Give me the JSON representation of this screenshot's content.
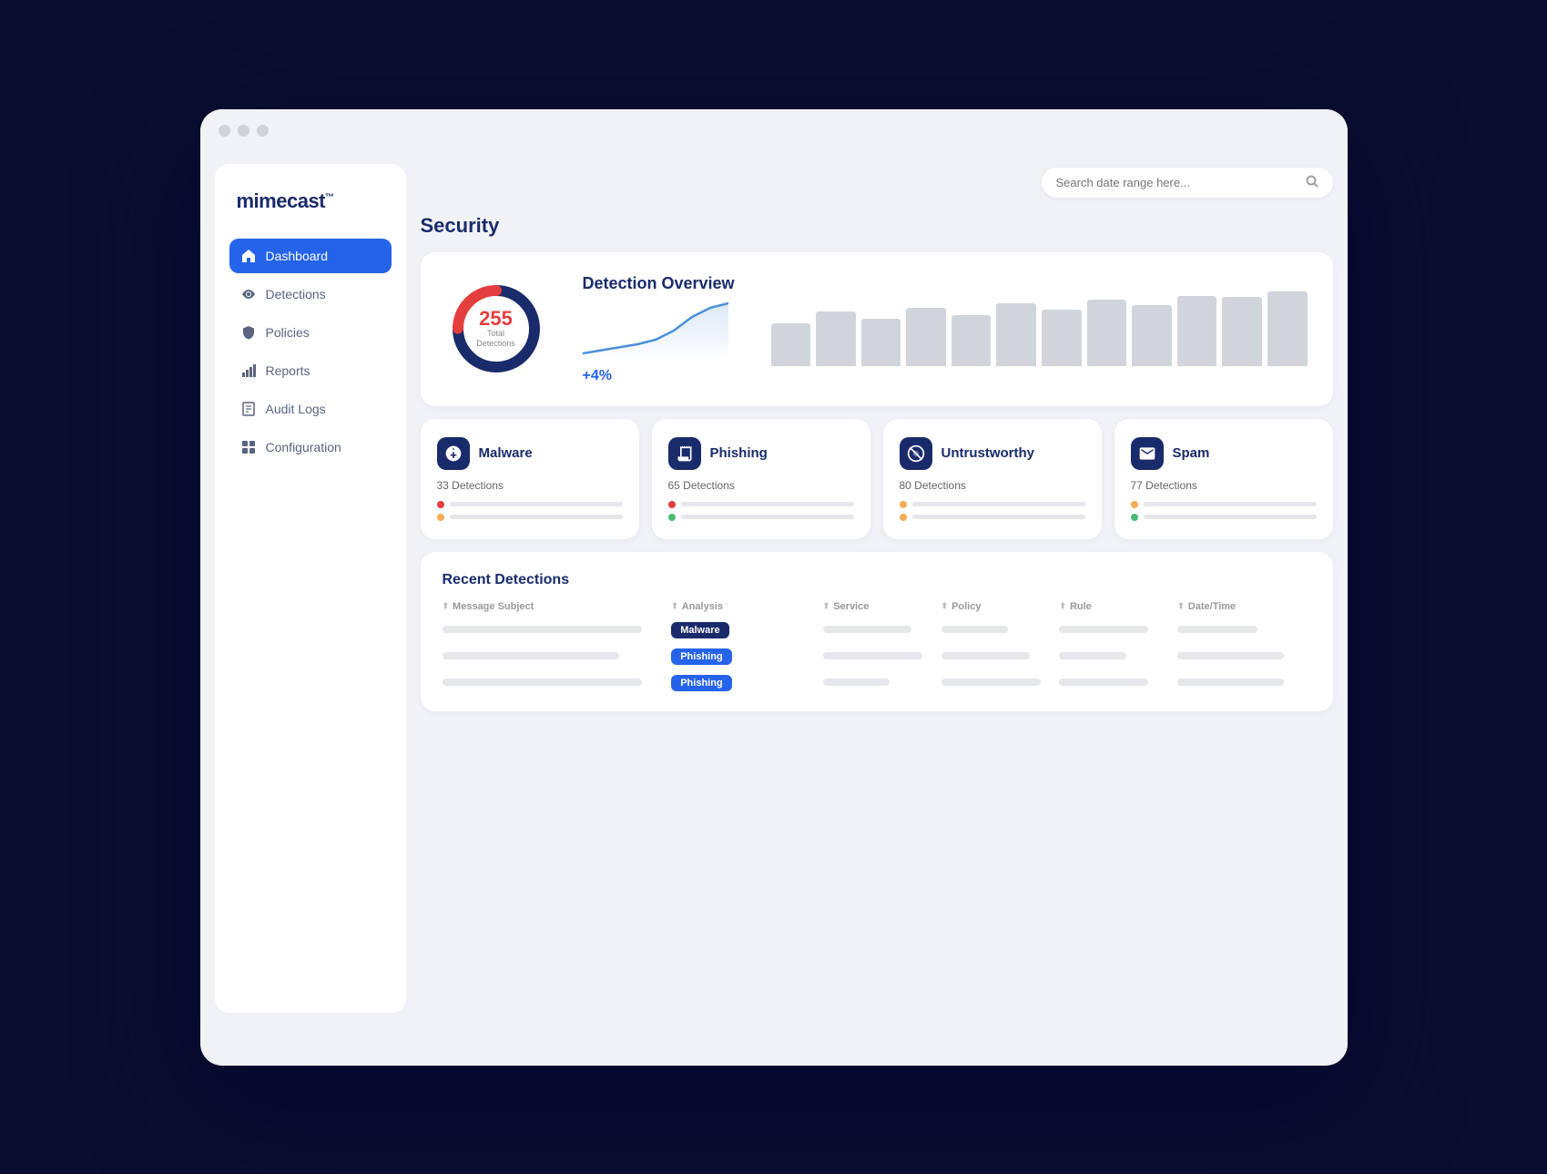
{
  "app": {
    "title": "mimecast",
    "title_sup": "™"
  },
  "sidebar": {
    "nav_items": [
      {
        "id": "dashboard",
        "label": "Dashboard",
        "icon": "🏠",
        "active": true
      },
      {
        "id": "detections",
        "label": "Detections",
        "icon": "👁",
        "active": false
      },
      {
        "id": "policies",
        "label": "Policies",
        "icon": "🛡",
        "active": false
      },
      {
        "id": "reports",
        "label": "Reports",
        "icon": "📊",
        "active": false
      },
      {
        "id": "audit-logs",
        "label": "Audit Logs",
        "icon": "📋",
        "active": false
      },
      {
        "id": "configuration",
        "label": "Configuration",
        "icon": "⊞",
        "active": false
      }
    ]
  },
  "search": {
    "placeholder": "Search date range here..."
  },
  "page": {
    "title": "Security"
  },
  "overview": {
    "title": "Detection Overview",
    "total": "255",
    "total_label": "Total Detections",
    "trend_pct": "+4%",
    "bars": [
      55,
      70,
      60,
      75,
      65,
      80,
      72,
      85,
      78,
      90,
      88,
      95
    ]
  },
  "detection_types": [
    {
      "id": "malware",
      "name": "Malware",
      "icon": "🪲",
      "count": "33 Detections",
      "bars": [
        {
          "color": "#e53e3e",
          "width": "70%"
        },
        {
          "color": "#f6ad55",
          "width": "45%"
        }
      ]
    },
    {
      "id": "phishing",
      "name": "Phishing",
      "icon": "🪝",
      "count": "65 Detections",
      "bars": [
        {
          "color": "#e53e3e",
          "width": "80%"
        },
        {
          "color": "#48bb78",
          "width": "55%"
        }
      ]
    },
    {
      "id": "untrustworthy",
      "name": "Untrustworthy",
      "icon": "⊕",
      "count": "80 Detections",
      "bars": [
        {
          "color": "#f6ad55",
          "width": "85%"
        },
        {
          "color": "#f6ad55",
          "width": "60%"
        }
      ]
    },
    {
      "id": "spam",
      "name": "Spam",
      "icon": "✉",
      "count": "77 Detections",
      "bars": [
        {
          "color": "#f6ad55",
          "width": "75%"
        },
        {
          "color": "#48bb78",
          "width": "65%"
        }
      ]
    }
  ],
  "recent_detections": {
    "title": "Recent Detections",
    "columns": [
      {
        "label": "Message Subject",
        "id": "message-subject"
      },
      {
        "label": "Analysis",
        "id": "analysis"
      },
      {
        "label": "Service",
        "id": "service"
      },
      {
        "label": "Policy",
        "id": "policy"
      },
      {
        "label": "Rule",
        "id": "rule"
      },
      {
        "label": "Date/Time",
        "id": "datetime"
      }
    ],
    "rows": [
      {
        "analysis_badge": "Malware",
        "analysis_type": "malware"
      },
      {
        "analysis_badge": "Phishing",
        "analysis_type": "phishing"
      },
      {
        "analysis_badge": "Phishing",
        "analysis_type": "phishing"
      }
    ]
  }
}
